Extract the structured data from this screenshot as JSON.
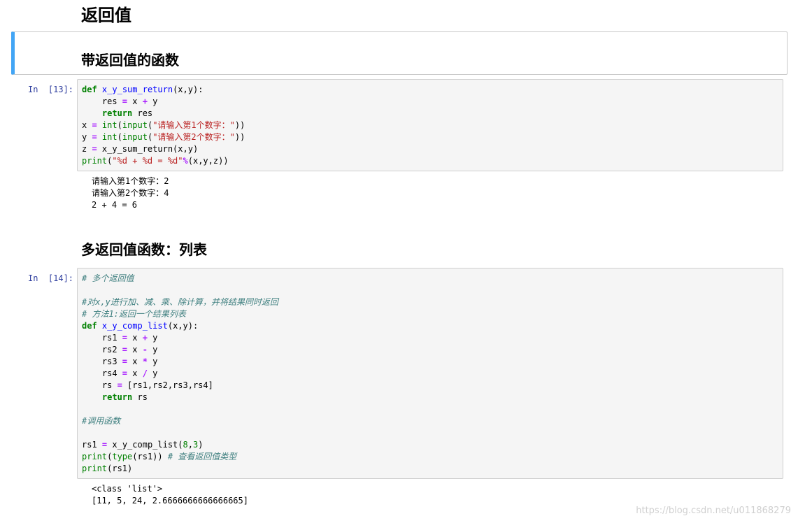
{
  "heading_main": "返回值",
  "cell_md1": {
    "heading": "带返回值的函数"
  },
  "cell13": {
    "prompt": "In  [13]:",
    "code": {
      "l1_kw": "def",
      "l1_fn": "x_y_sum_return",
      "l1_rest": "(x,y):",
      "l2_a": "    res ",
      "l2_op1": "=",
      "l2_b": " x ",
      "l2_op2": "+",
      "l2_c": " y",
      "l3_kw": "    return",
      "l3_rest": " res",
      "l4_a": "x ",
      "l4_op": "=",
      "l4_sp": " ",
      "l4_bi1": "int",
      "l4_p1": "(",
      "l4_bi2": "input",
      "l4_p2": "(",
      "l4_str": "\"请输入第1个数字：\"",
      "l4_end": "))",
      "l5_a": "y ",
      "l5_op": "=",
      "l5_sp": " ",
      "l5_bi1": "int",
      "l5_p1": "(",
      "l5_bi2": "input",
      "l5_p2": "(",
      "l5_str": "\"请输入第2个数字：\"",
      "l5_end": "))",
      "l6_a": "z ",
      "l6_op": "=",
      "l6_rest": " x_y_sum_return(x,y)",
      "l7_bi": "print",
      "l7_p": "(",
      "l7_str": "\"%d + %d = %d\"",
      "l7_op": "%",
      "l7_rest": "(x,y,z))"
    },
    "output": [
      "请输入第1个数字：2",
      "请输入第2个数字：4",
      "2 + 4 = 6"
    ]
  },
  "heading_md2": "多返回值函数：列表",
  "cell14": {
    "prompt": "In  [14]:",
    "code": {
      "c1": "# 多个返回值",
      "c2": "#对x,y进行加、减、乘、除计算，并将结果同时返回",
      "c3": "# 方法1:返回一个结果列表",
      "d_kw": "def",
      "d_fn": "x_y_comp_list",
      "d_rest": "(x,y):",
      "r1_a": "    rs1 ",
      "r1_op": "=",
      "r1_b": " x ",
      "r1_op2": "+",
      "r1_c": " y",
      "r2_a": "    rs2 ",
      "r2_op": "=",
      "r2_b": " x ",
      "r2_op2": "-",
      "r2_c": " y",
      "r3_a": "    rs3 ",
      "r3_op": "=",
      "r3_b": " x ",
      "r3_op2": "*",
      "r3_c": " y",
      "r4_a": "    rs4 ",
      "r4_op": "=",
      "r4_b": " x ",
      "r4_op2": "/",
      "r4_c": " y",
      "rs_a": "    rs ",
      "rs_op": "=",
      "rs_rest": " [rs1,rs2,rs3,rs4]",
      "ret_kw": "    return",
      "ret_rest": " rs",
      "c4": "#调用函数",
      "call_a": "rs1 ",
      "call_op": "=",
      "call_b": " x_y_comp_list(",
      "call_n1": "8",
      "call_comma": ",",
      "call_n2": "3",
      "call_end": ")",
      "p1_bi": "print",
      "p1_p": "(",
      "p1_bi2": "type",
      "p1_rest": "(rs1)) ",
      "p1_cm": "# 查看返回值类型",
      "p2_bi": "print",
      "p2_rest": "(rs1)"
    },
    "output": [
      "<class 'list'>",
      "[11, 5, 24, 2.6666666666666665]"
    ]
  },
  "watermark": "https://blog.csdn.net/u011868279"
}
